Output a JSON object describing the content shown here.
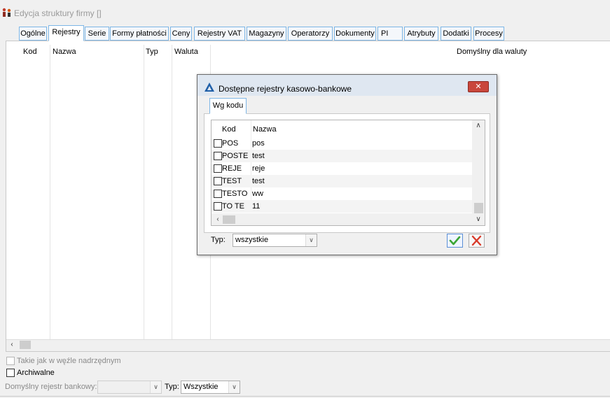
{
  "window": {
    "title": "Edycja struktury firmy []",
    "icon": "org-structure-icon"
  },
  "tabs": [
    {
      "label": "Ogólne"
    },
    {
      "label": "Rejestry"
    },
    {
      "label": "Serie"
    },
    {
      "label": "Formy płatności"
    },
    {
      "label": "Ceny"
    },
    {
      "label": "Rejestry VAT"
    },
    {
      "label": "Magazyny"
    },
    {
      "label": "Operatorzy"
    },
    {
      "label": "Dokumenty"
    },
    {
      "label": "PI"
    },
    {
      "label": "Atrybuty"
    },
    {
      "label": "Dodatki"
    },
    {
      "label": "Procesy"
    }
  ],
  "active_tab": "Rejestry",
  "main_list": {
    "columns": [
      "Kod",
      "Nazwa",
      "Typ",
      "Waluta",
      "Domyślny dla waluty"
    ],
    "rows": []
  },
  "bottom": {
    "same_as_parent_label": "Takie jak w węźle nadrzędnym",
    "same_as_parent_checked": false,
    "archived_label": "Archiwalne",
    "archived_checked": false,
    "default_bank_register_label": "Domyślny rejestr bankowy:",
    "default_bank_register_value": "",
    "type_label": "Typ:",
    "type_value": "Wszystkie"
  },
  "dialog": {
    "title": "Dostępne rejestry kasowo-bankowe",
    "icon": "registry-triangle-icon",
    "close_label": "✕",
    "tab_label": "Wg kodu",
    "columns": [
      "Kod",
      "Nazwa"
    ],
    "rows": [
      {
        "code": "POS",
        "name": "pos",
        "checked": false
      },
      {
        "code": "POSTE",
        "name": "test",
        "checked": false
      },
      {
        "code": "REJE",
        "name": "reje",
        "checked": false
      },
      {
        "code": "TEST",
        "name": "test",
        "checked": false
      },
      {
        "code": "TESTO",
        "name": "ww",
        "checked": false
      },
      {
        "code": "TO TE",
        "name": "11",
        "checked": false
      }
    ],
    "type_label": "Typ:",
    "type_value": "wszystkie",
    "ok_icon": "checkmark-icon",
    "cancel_icon": "cross-icon"
  },
  "colors": {
    "tab_border": "#7db6e6",
    "dialog_title_bg": "#dfe7f1",
    "close_button": "#c9473c",
    "ok_check": "#3aa635",
    "cancel_x": "#d93b2b"
  }
}
